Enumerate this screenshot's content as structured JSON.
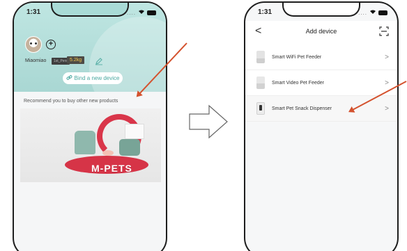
{
  "left_phone": {
    "status_time": "1:31",
    "username": "Miaomiao",
    "badge_label": "1st_Pers",
    "weight_badge": "5.2kg",
    "bind_button_label": "Bind a new device",
    "recommend_text": "Recommend you to buy other new products",
    "banner_brand": "M-PETS"
  },
  "right_phone": {
    "status_time": "1:31",
    "nav_title": "Add device",
    "back_glyph": "<",
    "devices": [
      {
        "label": "Smart WiFi Pet Feeder",
        "chevron": ">"
      },
      {
        "label": "Smart Video Pet Feeder",
        "chevron": ">"
      },
      {
        "label": "Smart Pet Snack Dispenser",
        "chevron": ">"
      }
    ]
  },
  "icons": {
    "avatar": "cat-avatar-icon",
    "add": "plus-circle-icon",
    "edit": "pencil-icon",
    "bind": "link-icon",
    "scan": "scan-icon",
    "back": "chevron-left-icon",
    "item": "chevron-right-icon",
    "wifi": "wifi-icon",
    "battery": "battery-icon"
  },
  "colors": {
    "header_teal": "#a9d7d3",
    "bind_text": "#4aa8a0",
    "annotation_arrow": "#d4522e",
    "brand_red": "#d63447",
    "weight_yellow": "#f2c64b"
  }
}
